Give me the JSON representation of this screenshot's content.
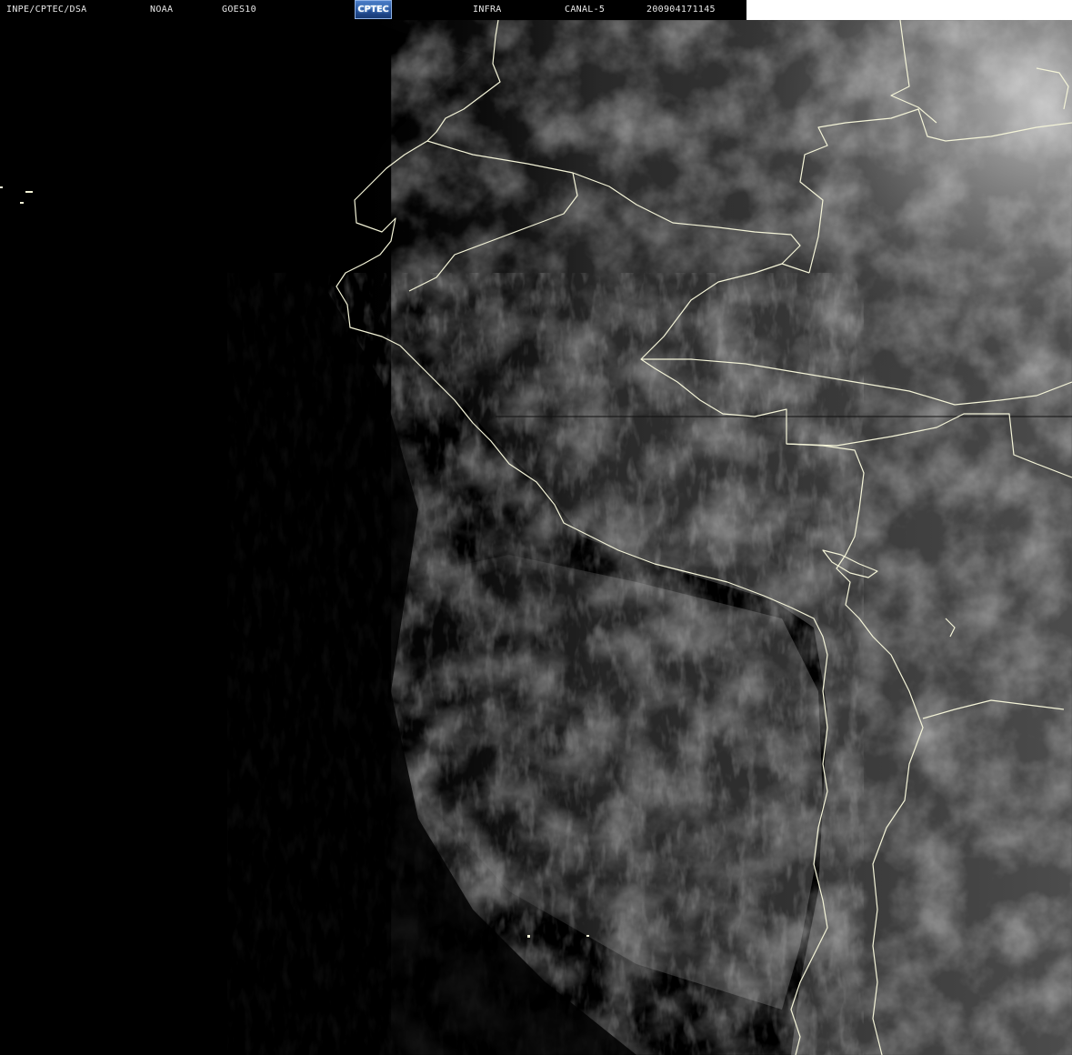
{
  "header": {
    "institution": "INPE/CPTEC/DSA",
    "agency": "NOAA",
    "satellite": "GOES10",
    "logo_text": "CPTEC",
    "product": "INFRA",
    "channel": "CANAL-5",
    "timestamp": "200904171145"
  },
  "colors": {
    "background": "#000000",
    "coastline": "#f4f4d8",
    "header_text": "#e8e8e8",
    "logo_blue": "#244f98"
  },
  "icons": {
    "logo": "cptec-logo"
  }
}
